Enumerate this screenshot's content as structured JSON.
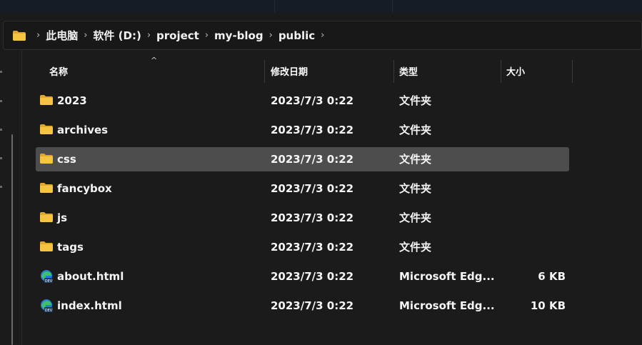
{
  "breadcrumb": {
    "items": [
      "此电脑",
      "软件 (D:)",
      "project",
      "my-blog",
      "public"
    ],
    "separator": "›"
  },
  "columns": {
    "name": "名称",
    "modified": "修改日期",
    "type": "类型",
    "size": "大小"
  },
  "files": [
    {
      "name": "2023",
      "modified": "2023/7/3 0:22",
      "type": "文件夹",
      "size": "",
      "icon": "folder-icon",
      "selected": false
    },
    {
      "name": "archives",
      "modified": "2023/7/3 0:22",
      "type": "文件夹",
      "size": "",
      "icon": "folder-icon",
      "selected": false
    },
    {
      "name": "css",
      "modified": "2023/7/3 0:22",
      "type": "文件夹",
      "size": "",
      "icon": "folder-icon",
      "selected": true
    },
    {
      "name": "fancybox",
      "modified": "2023/7/3 0:22",
      "type": "文件夹",
      "size": "",
      "icon": "folder-icon",
      "selected": false
    },
    {
      "name": "js",
      "modified": "2023/7/3 0:22",
      "type": "文件夹",
      "size": "",
      "icon": "folder-icon",
      "selected": false
    },
    {
      "name": "tags",
      "modified": "2023/7/3 0:22",
      "type": "文件夹",
      "size": "",
      "icon": "folder-icon",
      "selected": false
    },
    {
      "name": "about.html",
      "modified": "2023/7/3 0:22",
      "type": "Microsoft Edg...",
      "size": "6 KB",
      "icon": "edge-html-icon",
      "selected": false
    },
    {
      "name": "index.html",
      "modified": "2023/7/3 0:22",
      "type": "Microsoft Edg...",
      "size": "10 KB",
      "icon": "edge-html-icon",
      "selected": false
    }
  ],
  "colors": {
    "background": "#1b1b1b",
    "selected_row": "#4d4d4d",
    "folder_yellow": "#f5c542",
    "edge_blue": "#1f7fd6",
    "edge_green": "#3fbf6a"
  }
}
